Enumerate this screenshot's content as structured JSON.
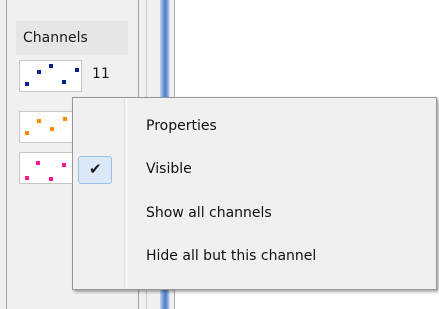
{
  "channels_panel": {
    "header": "Channels",
    "rows": [
      {
        "number": "11",
        "color": "#0a1f8f"
      },
      {
        "number": "",
        "color": "#ff8c00"
      },
      {
        "number": "",
        "color": "#ff1493"
      }
    ]
  },
  "context_menu": {
    "items": [
      {
        "label": "Properties",
        "checked": false
      },
      {
        "label": "Visible",
        "checked": true
      },
      {
        "label": "Show all channels",
        "checked": false
      },
      {
        "label": "Hide all but this channel",
        "checked": false
      }
    ],
    "check_glyph": "✔",
    "check_icon": "checkmark-icon"
  }
}
